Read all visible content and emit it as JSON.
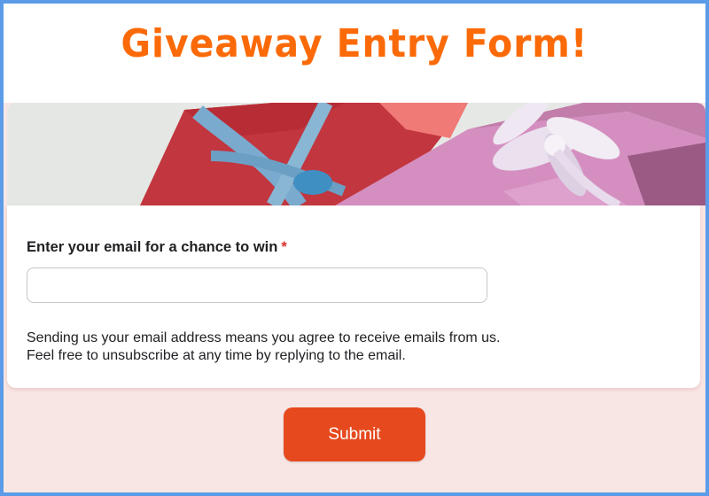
{
  "header": {
    "title": "Giveaway Entry Form!"
  },
  "banner": {
    "image": "gift-boxes-banner"
  },
  "form": {
    "email_label": "Enter your email for a chance to win",
    "required_marker": "*",
    "email_value": "",
    "help_lines": [
      "Sending us your email address means you agree to receive emails from us.",
      "Feel free to unsubscribe at any time by replying to the email."
    ],
    "submit_label": "Submit"
  },
  "colors": {
    "title": "#fb6a08",
    "submit": "#e6491d",
    "border": "#5b9be8",
    "background": "#f8e6e5",
    "required": "#d93025"
  }
}
